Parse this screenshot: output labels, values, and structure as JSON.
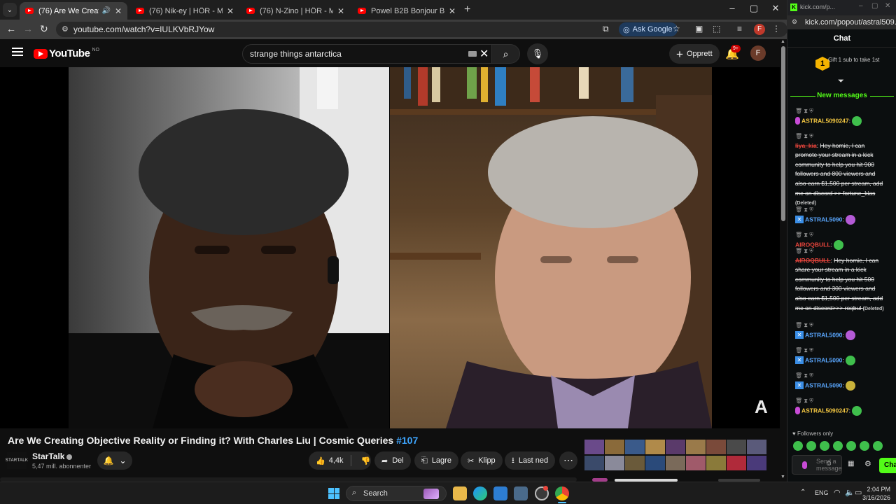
{
  "browser": {
    "tabs": [
      {
        "label": "(76) Are We Creating Objec",
        "active": true,
        "speaker": "🔊",
        "close": "✕"
      },
      {
        "label": "(76) Nik-ey | HÖR - March 16 /",
        "active": false,
        "close": "✕"
      },
      {
        "label": "(76) N-Zino | HÖR - March 16 /",
        "active": false,
        "close": "✕"
      },
      {
        "label": "Powel B2B Bonjour Ben | HÖR",
        "active": false,
        "close": "✕"
      }
    ],
    "new_tab": "+",
    "url": "youtube.com/watch?v=IULKVbRJYow",
    "ask_google": "Ask Google",
    "profile_initial": "F"
  },
  "youtube": {
    "logo_text": "YouTube",
    "country_code": "NO",
    "search": {
      "query": "strange things antarctica",
      "clear": "✕"
    },
    "create_label": "Opprett",
    "notif_count": "9+",
    "avatar_initial": "F",
    "video_title": "Are We Creating Objective Reality or Finding it? With Charles Liu | Cosmic Queries",
    "video_tag": "#107",
    "channel": {
      "logo_text": "STARTALK",
      "name": "StarTalk",
      "subscribers": "5,47 mill. abonnenter"
    },
    "actions": {
      "likes": "4,4k",
      "share": "Del",
      "save": "Lagre",
      "clip": "Klipp",
      "download": "Last ned",
      "more": "⋯"
    },
    "watermark": "A"
  },
  "kick": {
    "window_title": "kick.com/p...",
    "url": "kick.com/popout/astral509...",
    "chat_title": "Chat",
    "gift_number": "1",
    "gift_text": "Gift 1 sub to take 1st",
    "new_messages": "New messages",
    "messages": [
      {
        "user": "ASTRAL5090247",
        "user_color": "#f5c842",
        "text": "",
        "emote_color": "#3fbf4c",
        "badge": "mic"
      },
      {
        "user": "liya_kia",
        "user_color": "#e8453c",
        "text": "Hey homie, I can promote your stream in a kick community to help you hit 900 followers and 800 viewers and also earn $1,500 per stream, add me on discord >> fortune_kias",
        "deleted": "(Deleted)"
      },
      {
        "user": "ASTRAL5090",
        "user_color": "#5aa7ff",
        "text": "",
        "emote_color": "#b45ad6",
        "badge": "x"
      },
      {
        "user": "AIROQBULL",
        "user_color": "#e8453c",
        "text": "",
        "emote_color": "#3fbf4c"
      },
      {
        "user": "AIROQBULL",
        "user_color": "#e8453c",
        "text": "Hey homie, I can share your stream in a kick community to help you hit 500 followers and 300 viewers and also earn $1,500 per stream, add me on discord>>> roqbul",
        "deleted": "(Deleted)"
      },
      {
        "user": "ASTRAL5090",
        "user_color": "#5aa7ff",
        "text": "",
        "emote_color": "#b45ad6",
        "badge": "x"
      },
      {
        "user": "ASTRAL5090",
        "user_color": "#5aa7ff",
        "text": "",
        "emote_color": "#3fbf4c",
        "badge": "x"
      },
      {
        "user": "ASTRAL5090",
        "user_color": "#5aa7ff",
        "text": "",
        "emote_color": "#c9b23a",
        "badge": "x"
      },
      {
        "user": "ASTRAL5090247",
        "user_color": "#f5c842",
        "text": "",
        "emote_color": "#3fbf4c",
        "badge": "mic"
      }
    ],
    "followers_only": "Followers only",
    "send_placeholder": "Send a message",
    "chat_button": "Chat"
  },
  "taskbar": {
    "search_label": "Search",
    "lang": "ENG",
    "time": "2:04 PM",
    "date": "3/16/2026"
  },
  "colors": {
    "youtube_red": "#ff0000",
    "kick_green": "#53fc18",
    "link_blue": "#3ea6ff"
  }
}
